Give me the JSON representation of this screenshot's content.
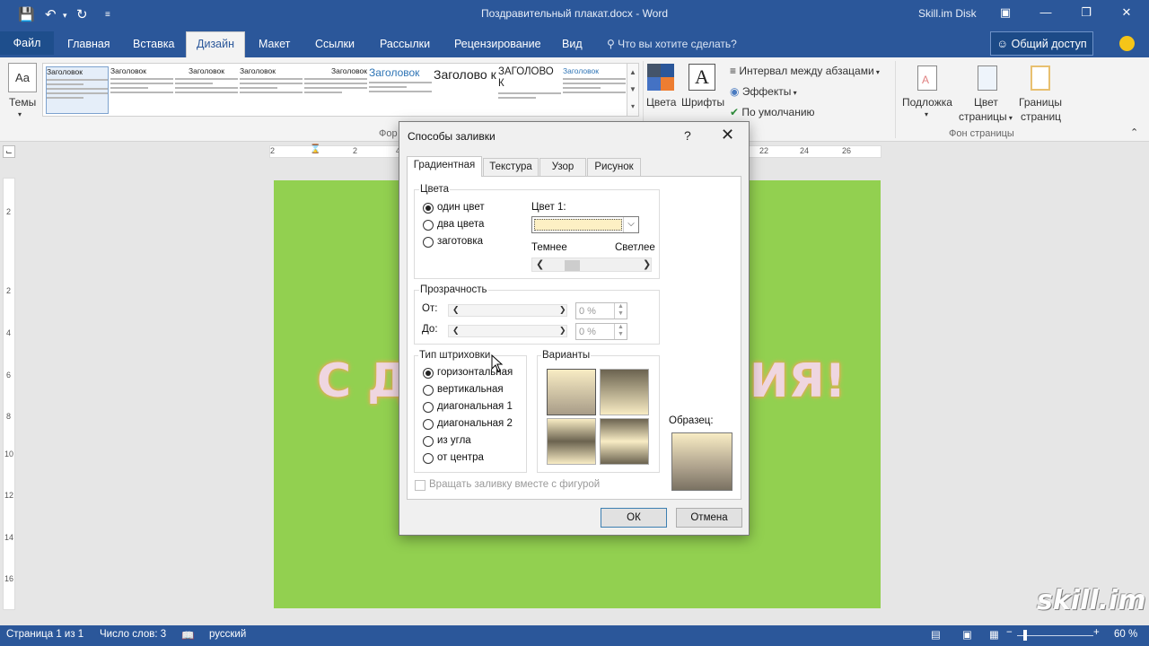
{
  "window": {
    "title": "Поздравительный плакат.docx - Word",
    "account": "Skill.im Disk"
  },
  "ribbon_tabs": [
    "Файл",
    "Главная",
    "Вставка",
    "Дизайн",
    "Макет",
    "Ссылки",
    "Рассылки",
    "Рецензирование",
    "Вид"
  ],
  "tell_me": "Что вы хотите сделать?",
  "share_button": "Общий доступ",
  "ribbon": {
    "themes_label": "Темы",
    "themes_icon_text": "Aa",
    "gallery_items": [
      {
        "heading": "Заголовок"
      },
      {
        "heading": "Заголовок"
      },
      {
        "heading": "Заголовок"
      },
      {
        "heading": "Заголовок"
      },
      {
        "heading": "Заголовок"
      },
      {
        "heading": "Заголовок"
      },
      {
        "heading": "Заголово к"
      },
      {
        "heading": "ЗАГОЛОВО К"
      },
      {
        "heading": "Заголовок"
      }
    ],
    "colors_label": "Цвета",
    "fonts_label": "Шрифты",
    "paragraph_spacing": "Интервал между абзацами",
    "effects": "Эффекты",
    "set_default": "По умолчанию",
    "watermark": "Подложка",
    "page_color_line1": "Цвет",
    "page_color_line2": "страницы",
    "page_borders_line1": "Границы",
    "page_borders_line2": "страниц",
    "group_format": "Фор",
    "group_page_background": "Фон страницы"
  },
  "hruler_numbers": [
    "2",
    "2",
    "4",
    "22",
    "24",
    "26"
  ],
  "vruler_numbers": [
    "2",
    "2",
    "4",
    "6",
    "8",
    "10",
    "12",
    "14",
    "16"
  ],
  "document": {
    "text_left": "С Д",
    "text_right": "ИЯ!"
  },
  "dialog": {
    "title": "Способы заливки",
    "help": "?",
    "close": "✕",
    "tabs": [
      "Градиентная",
      "Текстура",
      "Узор",
      "Рисунок"
    ],
    "colors": {
      "legend": "Цвета",
      "options": [
        "один цвет",
        "два цвета",
        "заготовка"
      ],
      "selected": 0,
      "color1_label": "Цвет 1:",
      "color1_value": "#fdf0c4",
      "darker": "Темнее",
      "lighter": "Светлее"
    },
    "transparency": {
      "legend": "Прозрачность",
      "from_label": "От:",
      "to_label": "До:",
      "from_value": "0 %",
      "to_value": "0 %"
    },
    "shading": {
      "legend": "Тип штриховки",
      "options": [
        "горизонтальная",
        "вертикальная",
        "диагональная 1",
        "диагональная 2",
        "из угла",
        "от центра"
      ],
      "selected": 0
    },
    "variants_legend": "Варианты",
    "sample_label": "Образец:",
    "rotate_with_shape": "Вращать заливку вместе с фигурой",
    "ok": "ОК",
    "cancel": "Отмена"
  },
  "statusbar": {
    "page": "Страница 1 из 1",
    "words": "Число слов: 3",
    "language": "русский",
    "zoom": "60 %"
  },
  "watermark_logo": "skill.im",
  "colors": {
    "word_blue": "#2b579a",
    "page_green": "#92d050",
    "gradient_light": "#f8ecc4",
    "gradient_dark": "#6b6350"
  }
}
